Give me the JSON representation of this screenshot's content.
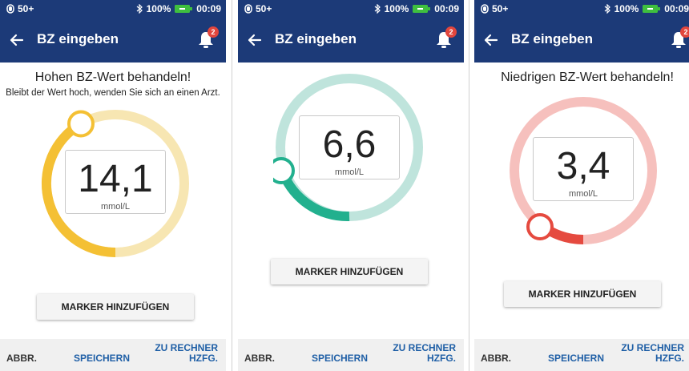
{
  "status": {
    "left_text": "50+",
    "battery_percent": "100%",
    "time": "00:09"
  },
  "appbar": {
    "title": "BZ eingeben",
    "notification_count": "2"
  },
  "colors": {
    "appbar": "#1c3a78",
    "high_track": "#f7e6b2",
    "high_fill": "#f4c034",
    "target_track": "#bfe4dc",
    "target_fill": "#22b08e",
    "low_track": "#f6c0bd",
    "low_fill": "#e54a3f",
    "link": "#1f5fa6"
  },
  "screens": [
    {
      "heading": "Hohen BZ-Wert behandeln!",
      "subtext": "Bleibt der Wert hoch, wenden Sie sich an einen Arzt.",
      "value": "14,1",
      "unit": "mmol/L",
      "marker_label": "MARKER HINZUFÜGEN",
      "gauge_level": 0.58,
      "cancel_label": "ABBR.",
      "save_label": "SPEICHERN",
      "calc_label_line1": "ZU RECHNER",
      "calc_label_line2": "HZFG."
    },
    {
      "heading": "",
      "subtext": "",
      "value": "6,6",
      "unit": "mmol/L",
      "marker_label": "MARKER HINZUFÜGEN",
      "gauge_level": 0.3,
      "cancel_label": "ABBR.",
      "save_label": "SPEICHERN",
      "calc_label_line1": "ZU RECHNER",
      "calc_label_line2": "HZFG."
    },
    {
      "heading": "Niedrigen BZ-Wert behandeln!",
      "subtext": "",
      "value": "3,4",
      "unit": "mmol/L",
      "marker_label": "MARKER HINZUFÜGEN",
      "gauge_level": 0.1,
      "cancel_label": "ABBR.",
      "save_label": "SPEICHERN",
      "calc_label_line1": "ZU RECHNER",
      "calc_label_line2": "HZFG."
    }
  ]
}
